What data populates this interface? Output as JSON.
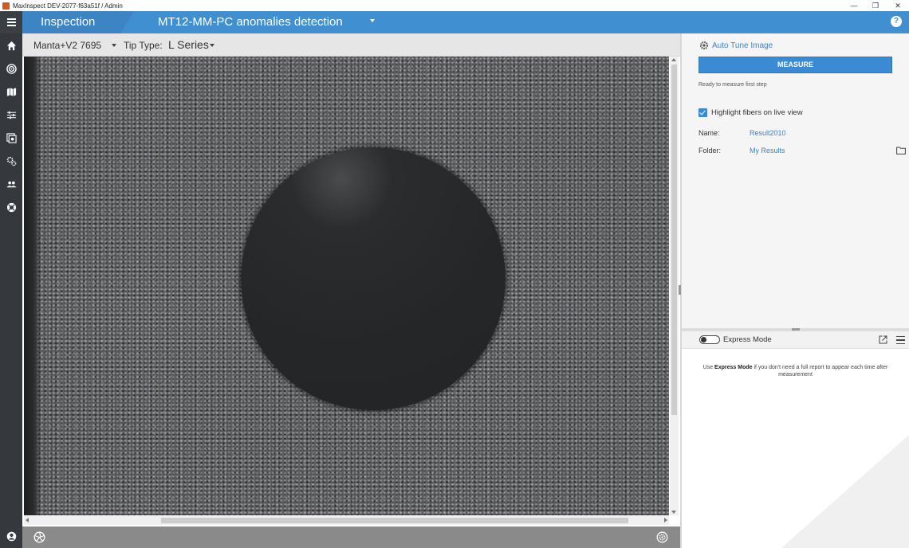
{
  "window": {
    "title": "MaxInspect DEV-2077-f63a51f / Admin",
    "controls": {
      "minimize": "—",
      "restore": "❐",
      "close": "✕"
    }
  },
  "header": {
    "section_title": "Inspection",
    "document_title": "MT12-MM-PC anomalies detection",
    "help_label": "?"
  },
  "sidebar": {
    "items": [
      {
        "icon": "home-icon"
      },
      {
        "icon": "target-icon"
      },
      {
        "icon": "map-icon"
      },
      {
        "icon": "sliders-icon"
      },
      {
        "icon": "gallery-icon"
      },
      {
        "icon": "gears-icon"
      },
      {
        "icon": "users-icon"
      },
      {
        "icon": "lifebuoy-icon"
      }
    ],
    "bottom_icon": "user-avatar-icon"
  },
  "toolbar": {
    "camera": "Manta+V2 7695",
    "tip_type_label": "Tip Type:",
    "tip_type_value": "L Series"
  },
  "right_panel": {
    "auto_tune_label": "Auto Tune Image",
    "measure_label": "MEASURE",
    "status_text": "Ready to measure first step",
    "highlight_label": "Highlight fibers on live view",
    "highlight_checked": true,
    "name_label": "Name:",
    "name_value": "Result2010",
    "folder_label": "Folder:",
    "folder_value": "My Results"
  },
  "express": {
    "label": "Express Mode",
    "enabled": false,
    "info_prefix": "Use ",
    "info_bold": "Express Mode",
    "info_suffix": " if you don't need a full report to appear each time after measurement"
  },
  "colors": {
    "accent": "#3f8fd1",
    "sidebar_bg": "#35393e",
    "link": "#3c82c8"
  }
}
